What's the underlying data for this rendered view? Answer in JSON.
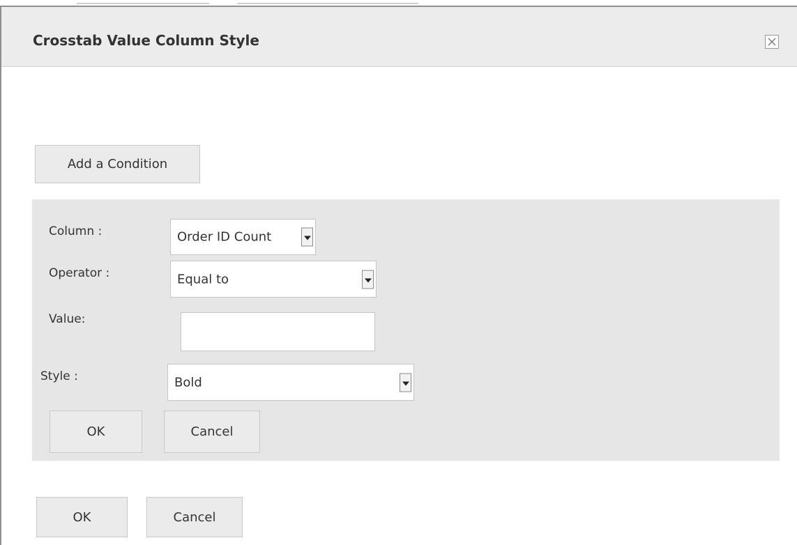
{
  "dialog": {
    "title": "Crosstab Value Column Style",
    "close_icon": "close-icon"
  },
  "add_condition_button": "Add a Condition",
  "condition_form": {
    "column": {
      "label": "Column :",
      "value": "Order ID Count"
    },
    "operator": {
      "label": "Operator :",
      "value": "Equal to"
    },
    "value": {
      "label": "Value:",
      "current": ""
    },
    "style": {
      "label": "Style :",
      "value": "Bold"
    },
    "ok_label": "OK",
    "cancel_label": "Cancel"
  },
  "footer": {
    "ok_label": "OK",
    "cancel_label": "Cancel"
  },
  "colors": {
    "header_bg": "#ececec",
    "panel_bg": "#e6e6e6",
    "button_bg": "#ebebeb"
  }
}
